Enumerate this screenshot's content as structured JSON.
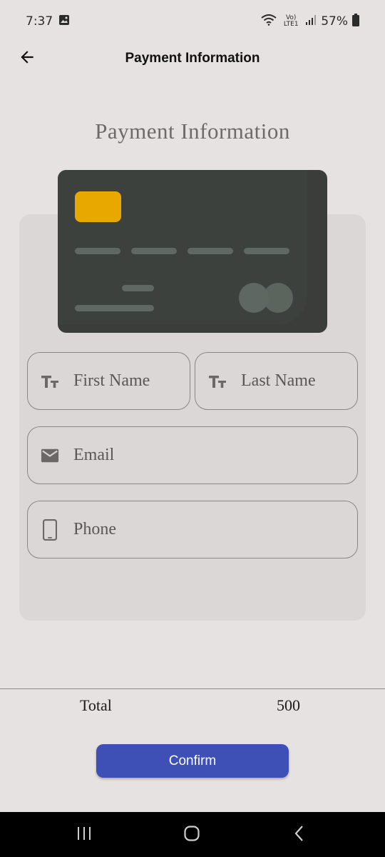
{
  "status_bar": {
    "time": "7:37",
    "battery": "57%",
    "network_label": "Vo) LTE1",
    "icons": [
      "gallery-icon",
      "wifi-icon",
      "signal-icon",
      "battery-icon"
    ]
  },
  "app_bar": {
    "title": "Payment Information",
    "back_icon": "arrow-left-icon"
  },
  "page": {
    "heading": "Payment Information"
  },
  "card_colors": {
    "body": "#3a3d3a",
    "chip": "#e9a800",
    "lines": "#5f6862"
  },
  "form": {
    "first_name": {
      "placeholder": "First Name",
      "icon": "text-fields-icon"
    },
    "last_name": {
      "placeholder": "Last Name",
      "icon": "text-fields-icon"
    },
    "email": {
      "placeholder": "Email",
      "icon": "mail-icon"
    },
    "phone": {
      "placeholder": "Phone",
      "icon": "phone-icon"
    }
  },
  "summary": {
    "total_label": "Total",
    "total_value": "500"
  },
  "actions": {
    "confirm_label": "Confirm",
    "confirm_color": "#3e50b5"
  },
  "nav_bar": {
    "icons": [
      "recents-icon",
      "home-icon",
      "back-icon"
    ]
  }
}
